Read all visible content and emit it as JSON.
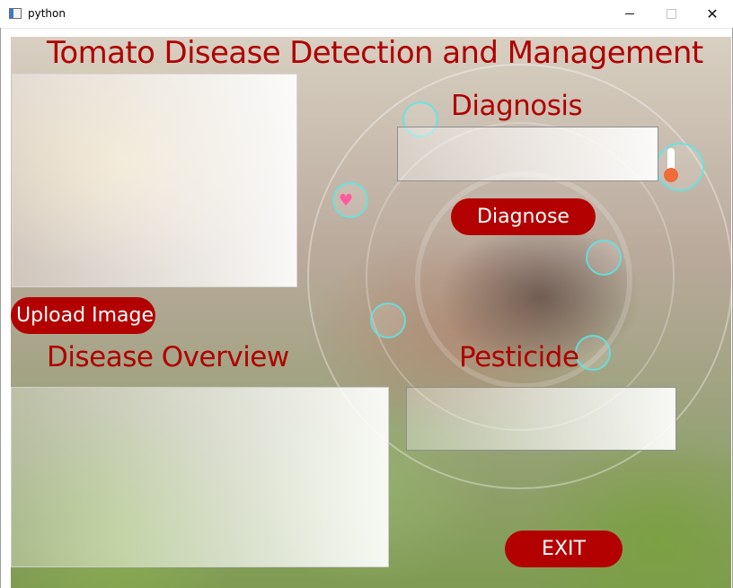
{
  "window": {
    "title": "python",
    "minimize_label": "—",
    "maximize_label": "☐",
    "close_label": "✕"
  },
  "app": {
    "title": "Tomato Disease Detection and Management",
    "diagnosis_heading": "Diagnosis",
    "diagnose_button": "Diagnose",
    "upload_button": "Upload Image",
    "overview_heading": "Disease Overview",
    "pesticide_heading": "Pesticide",
    "exit_button": "EXIT",
    "diagnosis_value": "",
    "overview_value": "",
    "pesticide_value": ""
  },
  "theme": {
    "accent": "#b00000",
    "button_bg": "#b30000",
    "button_text": "#ffffff"
  },
  "icons": [
    "app-window-icon",
    "heart-icon",
    "thermometer-icon"
  ]
}
